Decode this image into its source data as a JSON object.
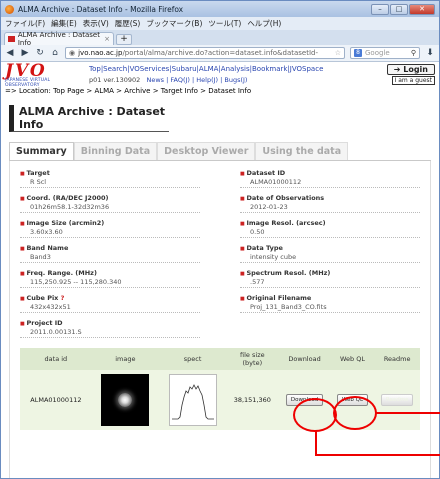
{
  "browser": {
    "title": "ALMA Archive : Dataset Info - Mozilla Firefox",
    "menu": [
      "ファイル(F)",
      "編集(E)",
      "表示(V)",
      "履歴(S)",
      "ブックマーク(B)",
      "ツール(T)",
      "ヘルプ(H)"
    ],
    "tab_label": "ALMA Archive : Dataset Info",
    "url_host": "jvo.nao.ac.jp",
    "url_path": "/portal/alma/archive.do?action=dataset.info&datasetId-",
    "search_placeholder": "Google",
    "controls": {
      "minimize": "–",
      "maximize": "□",
      "close": "✕"
    }
  },
  "jvo": {
    "logo": "JVO",
    "logo_sub": "JAPANESE VIRTUAL OBSERVATORY",
    "nav_links": "Top|Search|VOServices|Subaru|ALMA|Analysis|Bookmark|JVOSpace",
    "version": "p01 ver.130902",
    "sub_links": "News | FAQ(J) | Help(J) | Bugs(J)",
    "login_label": "Login",
    "guest_label": "I am a guest",
    "location": "=> Location: Top Page > ALMA > Archive > Target Info > Dataset Info"
  },
  "page_title": "ALMA Archive : Dataset Info",
  "tabs": [
    "Summary",
    "Binning Data",
    "Desktop Viewer",
    "Using the data"
  ],
  "fields_left": [
    {
      "label": "Target",
      "value": "R Scl"
    },
    {
      "label": "Coord. (RA/DEC J2000)",
      "value": "01h26m58.1-32d32m36"
    },
    {
      "label": "Image Size (arcmin2)",
      "value": "3.60x3.60"
    },
    {
      "label": "Band Name",
      "value": "Band3"
    },
    {
      "label": "Freq. Range. (MHz)",
      "value": "115,250.925 -- 115,280.340"
    },
    {
      "label": "Cube Pix",
      "value": "432x432x51",
      "help": "?"
    },
    {
      "label": "Project ID",
      "value": "2011.0.00131.S"
    }
  ],
  "fields_right": [
    {
      "label": "Dataset ID",
      "value": "ALMA01000112"
    },
    {
      "label": "Date of Observations",
      "value": "2012-01-23"
    },
    {
      "label": "Image Resol. (arcsec)",
      "value": "0.50"
    },
    {
      "label": "Data Type",
      "value": "intensity cube"
    },
    {
      "label": "Spectrum Resol. (MHz)",
      "value": ".577"
    },
    {
      "label": "Original Filename",
      "value": "Proj_131_Band3_CO.fits"
    }
  ],
  "table": {
    "headers": [
      "data id",
      "image",
      "spect",
      "file size\n(byte)",
      "Download",
      "Web QL",
      "Readme"
    ],
    "row": {
      "data_id": "ALMA01000112",
      "file_size": "38,151,360",
      "download_btn": "Download",
      "webql_btn": "Web QL"
    }
  }
}
